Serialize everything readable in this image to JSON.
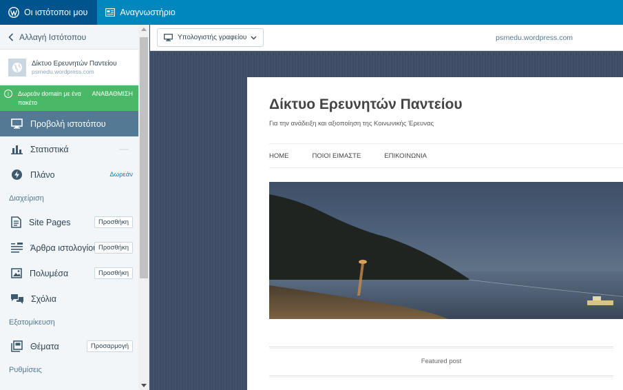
{
  "masterbar": {
    "my_sites": "Οι ιστότοποι μου",
    "reader": "Αναγνωστήριο"
  },
  "sidebar": {
    "switch_site": "Αλλαγή Ιστότοπου",
    "site": {
      "name": "Δίκτυο Ερευνητών Παντείου",
      "url": "psrnedu.wordpress.com"
    },
    "notice": {
      "message": "Δωρεάν domain με ένα πακέτο",
      "cta": "ΑΝΑΒΑΘΜΙΣΗ"
    },
    "items": {
      "view_site": "Προβολή ιστοτόπου",
      "stats": "Στατιστικά",
      "plan": "Πλάνο",
      "plan_badge": "Δωρεάν",
      "manage_heading": "Διαχείριση",
      "site_pages": "Site Pages",
      "posts": "Άρθρα ιστολογίου",
      "media": "Πολυμέσα",
      "comments": "Σχόλια",
      "add_label": "Προσθήκη",
      "personalize_heading": "Εξατομίκευση",
      "themes": "Θέματα",
      "customize_label": "Προσαρμογή",
      "settings_heading": "Ρυθμίσεις"
    }
  },
  "preview": {
    "device": "Υπολογιστής γραφείου",
    "url": "psrnedu.wordpress.com",
    "site_title": "Δίκτυο Ερευνητών Παντείου",
    "tagline": "Για την ανάδειξη και αξιοποίηση της Κοινωνικής Έρευνας",
    "nav": [
      "HOME",
      "ΠΟΙΟΙ ΕΙΜΑΣΤΕ",
      "ΕΠΙΚΟΙΝΩΝΙΑ"
    ],
    "featured": "Featured post"
  },
  "colors": {
    "masterbar": "#0087be",
    "masterbar_active": "#00548d",
    "notice": "#4ab866",
    "selected_item": "#537994"
  },
  "icons": [
    "wordpress-logo-icon",
    "reader-icon",
    "chevron-left-icon",
    "globe-icon",
    "info-icon",
    "desktop-icon",
    "stats-icon",
    "plan-icon",
    "pages-icon",
    "posts-icon",
    "media-icon",
    "comments-icon",
    "themes-icon",
    "chevron-down-icon"
  ]
}
